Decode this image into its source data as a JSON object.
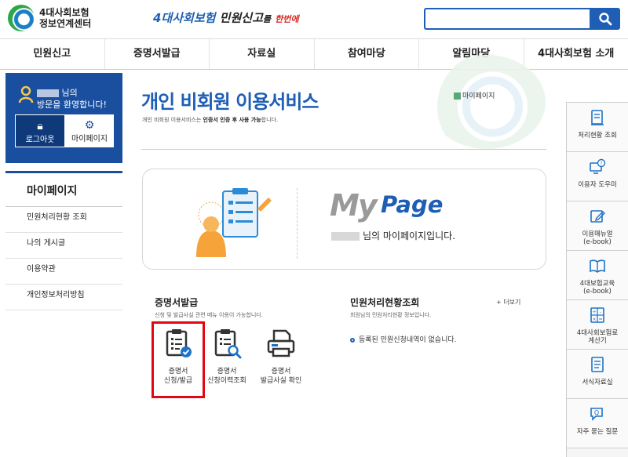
{
  "header": {
    "logo_line1": "4대사회보험",
    "logo_line2": "정보연계센터",
    "slogan_part1": "4대사회보험",
    "slogan_part2": "민원신고",
    "slogan_part3": "를",
    "slogan_part4": "한번에",
    "search": {
      "value": "",
      "placeholder": ""
    }
  },
  "nav": [
    "민원신고",
    "증명서발급",
    "자료실",
    "참여마당",
    "알림마당",
    "4대사회보험 소개"
  ],
  "user": {
    "name_suffix": "님의",
    "welcome": "방문을 환영합니다!",
    "logout": "로그아웃",
    "mypage": "마이페이지"
  },
  "sidebar": {
    "title": "마이페이지",
    "items": [
      "민원처리현황 조회",
      "나의 게시글",
      "이용약관",
      "개인정보처리방침"
    ]
  },
  "main": {
    "title": "개인 비회원 이용서비스",
    "desc_pre": "개인 비회원 이용서비스는 ",
    "desc_bold": "인증서 인증 후 사용 가능",
    "desc_post": "합니다.",
    "mypage_link": "마이페이지",
    "card_word1": "My",
    "card_word2": "Page",
    "card_msg": "님의 마이페이지입니다."
  },
  "cert": {
    "title": "증명서발급",
    "desc": "신청 및 발급사실 관련 메뉴 이용이 가능합니다.",
    "items": [
      {
        "line1": "증명서",
        "line2": "신청/발급"
      },
      {
        "line1": "증명서",
        "line2": "신청이력조회"
      },
      {
        "line1": "증명서",
        "line2": "발급사실 확인"
      }
    ]
  },
  "status": {
    "title": "민원처리현황조회",
    "desc": "회원님의 민원처리현황 정보입니다.",
    "more": "+ 더보기",
    "empty": "등록된 민원신청내역이 없습니다."
  },
  "quick": [
    {
      "line1": "처리현황 조회",
      "line2": ""
    },
    {
      "line1": "이용자 도우미",
      "line2": ""
    },
    {
      "line1": "이용매뉴얼",
      "line2": "(e-book)"
    },
    {
      "line1": "4대보험교육",
      "line2": "(e-book)"
    },
    {
      "line1": "4대사회보험료",
      "line2": "계산기"
    },
    {
      "line1": "서식자료실",
      "line2": ""
    },
    {
      "line1": "자주 묻는 질문",
      "line2": ""
    }
  ],
  "colors": {
    "brand_blue": "#1e5fb5",
    "panel_blue": "#1a4fa0",
    "highlight_red": "#e30613"
  }
}
